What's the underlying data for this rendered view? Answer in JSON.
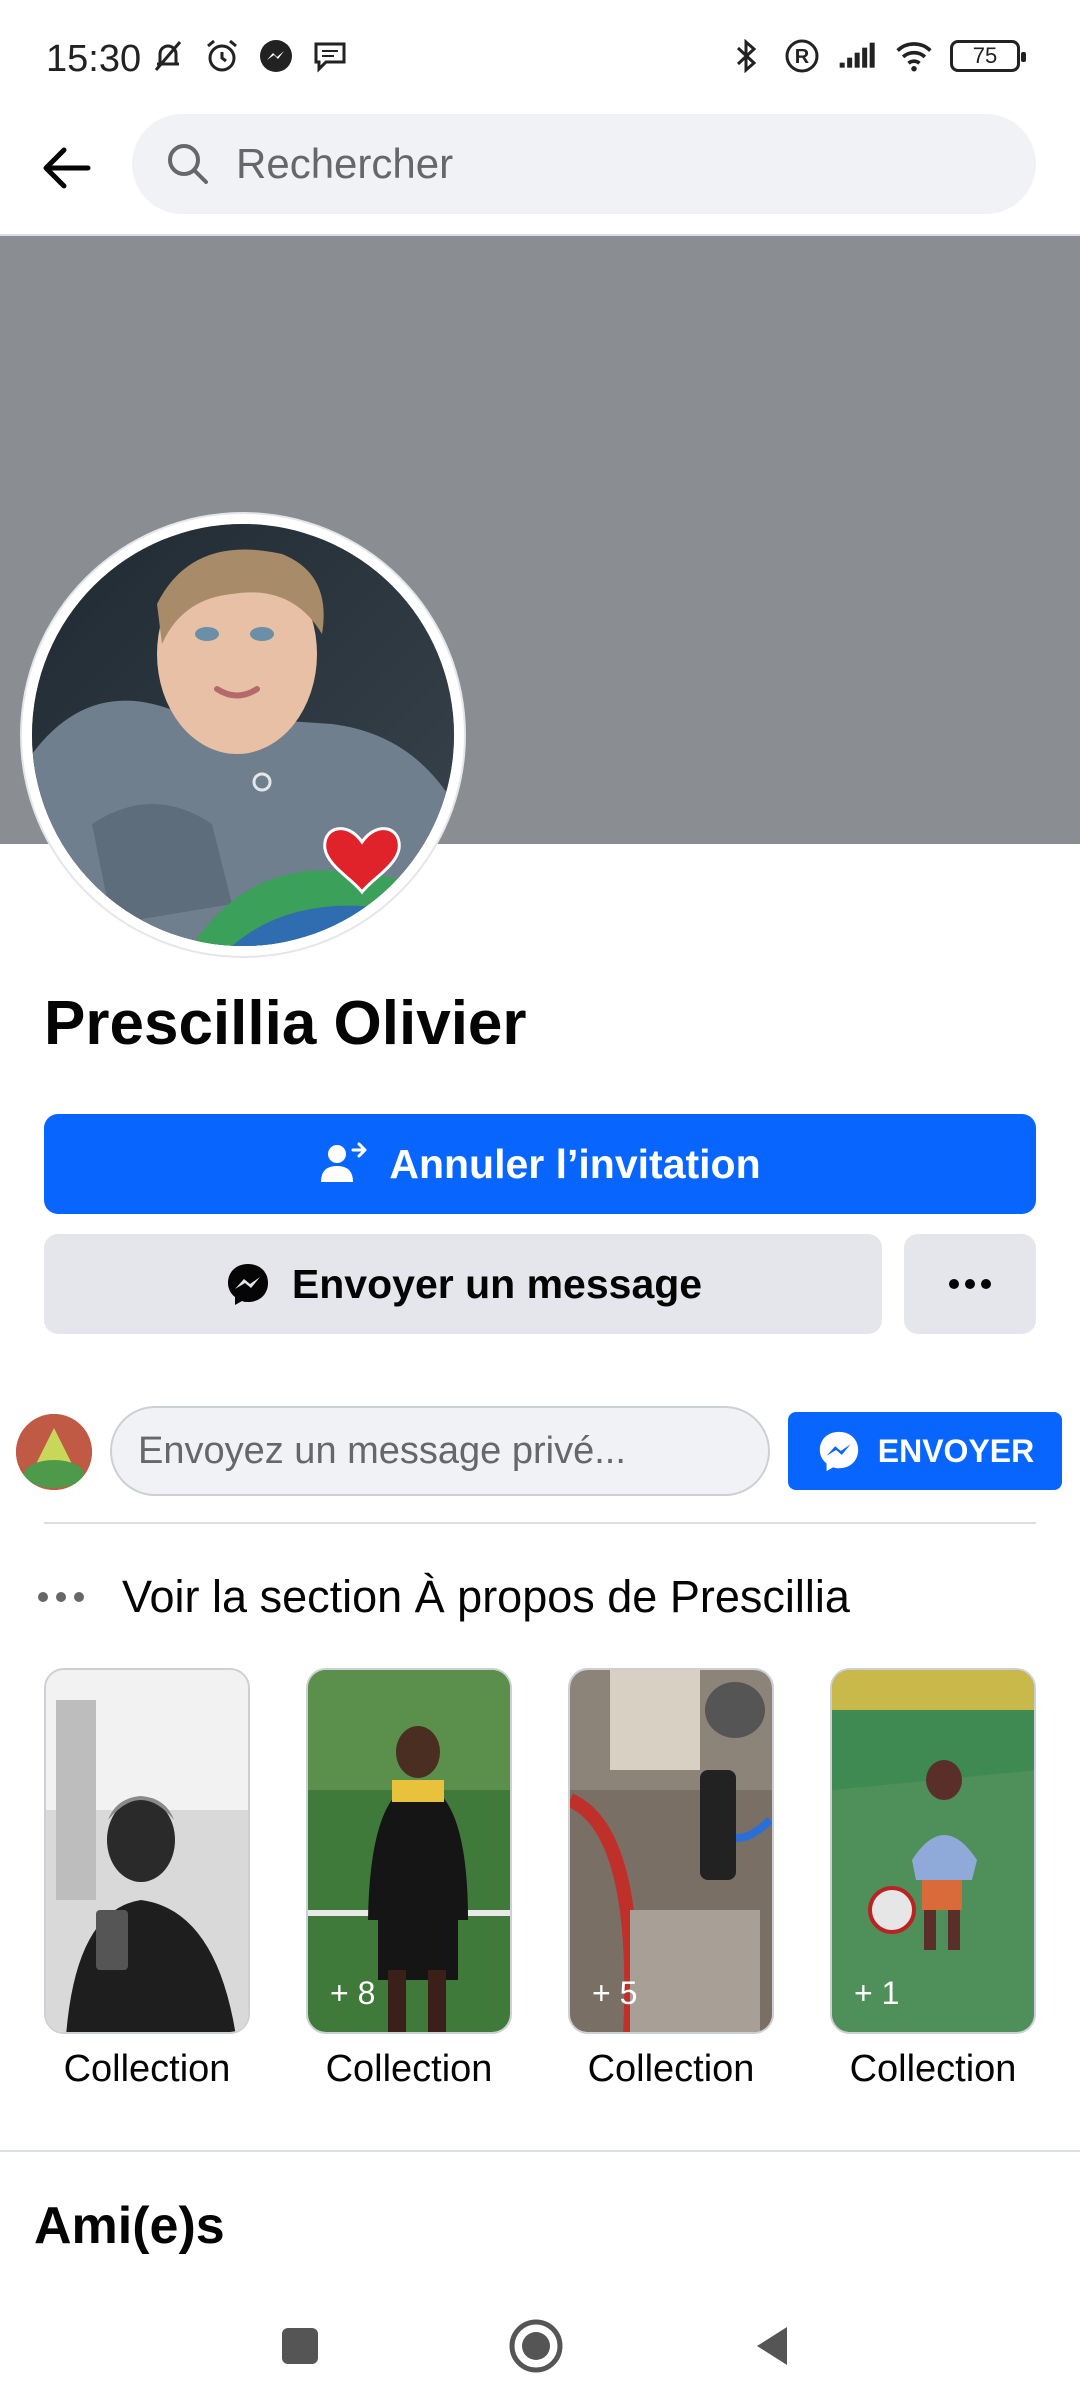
{
  "status_bar": {
    "time": "15:30",
    "battery": "75"
  },
  "search": {
    "placeholder": "Rechercher"
  },
  "profile": {
    "name": "Prescillia Olivier"
  },
  "actions": {
    "cancel_invite": "Annuler l’invitation",
    "send_message": "Envoyer un message"
  },
  "private_message": {
    "placeholder": "Envoyez un message privé...",
    "send_label": "ENVOYER"
  },
  "about": {
    "label": "Voir la section À propos de Prescillia"
  },
  "collections": [
    {
      "label": "Collection",
      "count": ""
    },
    {
      "label": "Collection",
      "count": "+ 8"
    },
    {
      "label": "Collection",
      "count": "+ 5"
    },
    {
      "label": "Collection",
      "count": "+ 1"
    }
  ],
  "friends": {
    "title": "Ami(e)s"
  },
  "colors": {
    "primary": "#0866ff",
    "secondary_bg": "#e4e6eb",
    "cover": "#8a8d91"
  },
  "icons": [
    "back-arrow-icon",
    "search-icon",
    "add-friend-icon",
    "messenger-icon",
    "more-icon",
    "square-nav-icon",
    "home-nav-icon",
    "back-nav-icon"
  ]
}
